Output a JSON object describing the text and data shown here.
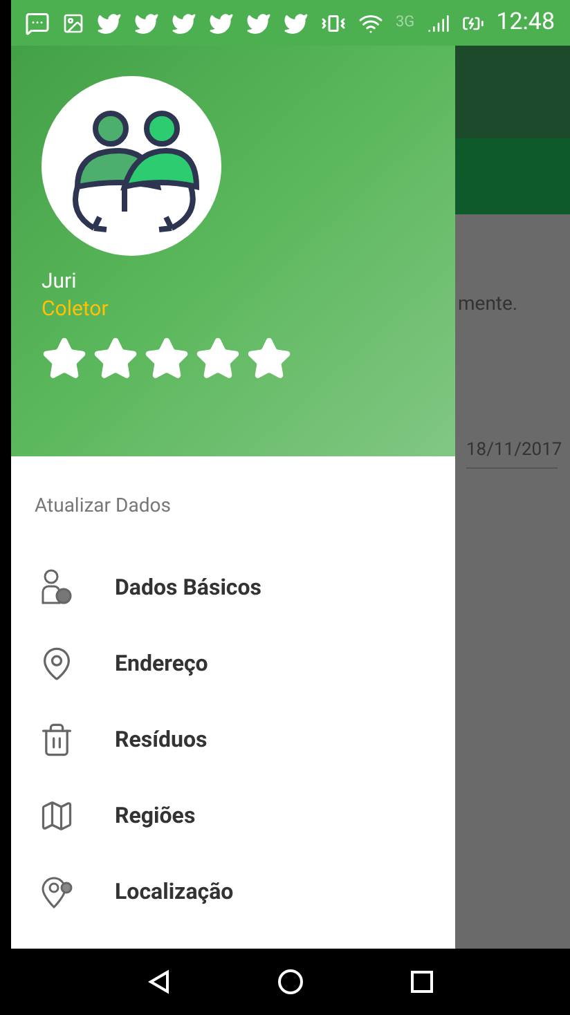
{
  "status_bar": {
    "network": "3G",
    "time": "12:48"
  },
  "drawer": {
    "user": {
      "name": "Juri",
      "role": "Coletor",
      "stars": 5
    },
    "section_title": "Atualizar Dados",
    "items": [
      {
        "kind": "user",
        "label": "Dados Básicos"
      },
      {
        "kind": "pin",
        "label": "Endereço"
      },
      {
        "kind": "trash",
        "label": "Resíduos"
      },
      {
        "kind": "map",
        "label": "Regiões"
      },
      {
        "kind": "location",
        "label": "Localização"
      }
    ]
  },
  "background": {
    "text": "mente.",
    "date": "18/11/2017"
  }
}
